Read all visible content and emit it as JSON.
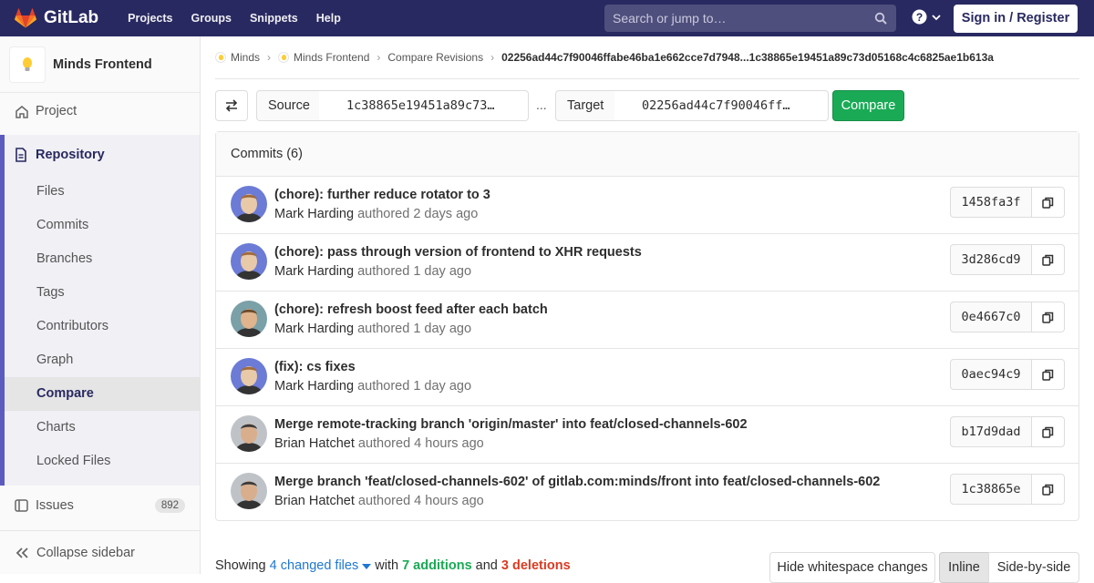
{
  "topbar": {
    "brand": "GitLab",
    "nav": [
      "Projects",
      "Groups",
      "Snippets",
      "Help"
    ],
    "search_placeholder": "Search or jump to…",
    "signin": "Sign in / Register"
  },
  "sidebar": {
    "project_name": "Minds Frontend",
    "project": "Project",
    "repository": "Repository",
    "repo_items": [
      "Files",
      "Commits",
      "Branches",
      "Tags",
      "Contributors",
      "Graph",
      "Compare",
      "Charts",
      "Locked Files"
    ],
    "active_item": "Compare",
    "issues": "Issues",
    "issues_count": "892",
    "collapse": "Collapse sidebar"
  },
  "breadcrumbs": {
    "group": "Minds",
    "project": "Minds Frontend",
    "section": "Compare Revisions",
    "current": "02256ad44c7f90046ffabe46ba1e662cce7d7948...1c38865e19451a89c73d05168c4c6825ae1b613a"
  },
  "compare_form": {
    "source_label": "Source",
    "source_value": "1c38865e19451a89c73…",
    "separator": "...",
    "target_label": "Target",
    "target_value": "02256ad44c7f90046ff…",
    "compare_button": "Compare"
  },
  "commits": {
    "header": "Commits (6)",
    "items": [
      {
        "title": "(chore): further reduce rotator to 3",
        "author": "Mark Harding",
        "time": "authored 2 days ago",
        "sha": "1458fa3f"
      },
      {
        "title": "(chore): pass through version of frontend to XHR requests",
        "author": "Mark Harding",
        "time": "authored 1 day ago",
        "sha": "3d286cd9"
      },
      {
        "title": "(chore): refresh boost feed after each batch",
        "author": "Mark Harding",
        "time": "authored 1 day ago",
        "sha": "0e4667c0"
      },
      {
        "title": "(fix): cs fixes",
        "author": "Mark Harding",
        "time": "authored 1 day ago",
        "sha": "0aec94c9"
      },
      {
        "title": "Merge remote-tracking branch 'origin/master' into feat/closed-channels-602",
        "author": "Brian Hatchet",
        "time": "authored 4 hours ago",
        "sha": "b17d9dad"
      },
      {
        "title": "Merge branch 'feat/closed-channels-602' of gitlab.com:minds/front into feat/closed-channels-602",
        "author": "Brian Hatchet",
        "time": "authored 4 hours ago",
        "sha": "1c38865e"
      }
    ]
  },
  "summary": {
    "showing": "Showing",
    "changed": "4 changed files",
    "with": "with",
    "additions": "7 additions",
    "and": "and",
    "deletions": "3 deletions"
  },
  "diff_controls": {
    "whitespace": "Hide whitespace changes",
    "inline": "Inline",
    "side_by_side": "Side-by-side"
  },
  "colors": {
    "topbar": "#292961",
    "compare_button": "#1aaa55",
    "additions": "#1aaa55",
    "deletions": "#db3b21",
    "link": "#1f78d1"
  }
}
